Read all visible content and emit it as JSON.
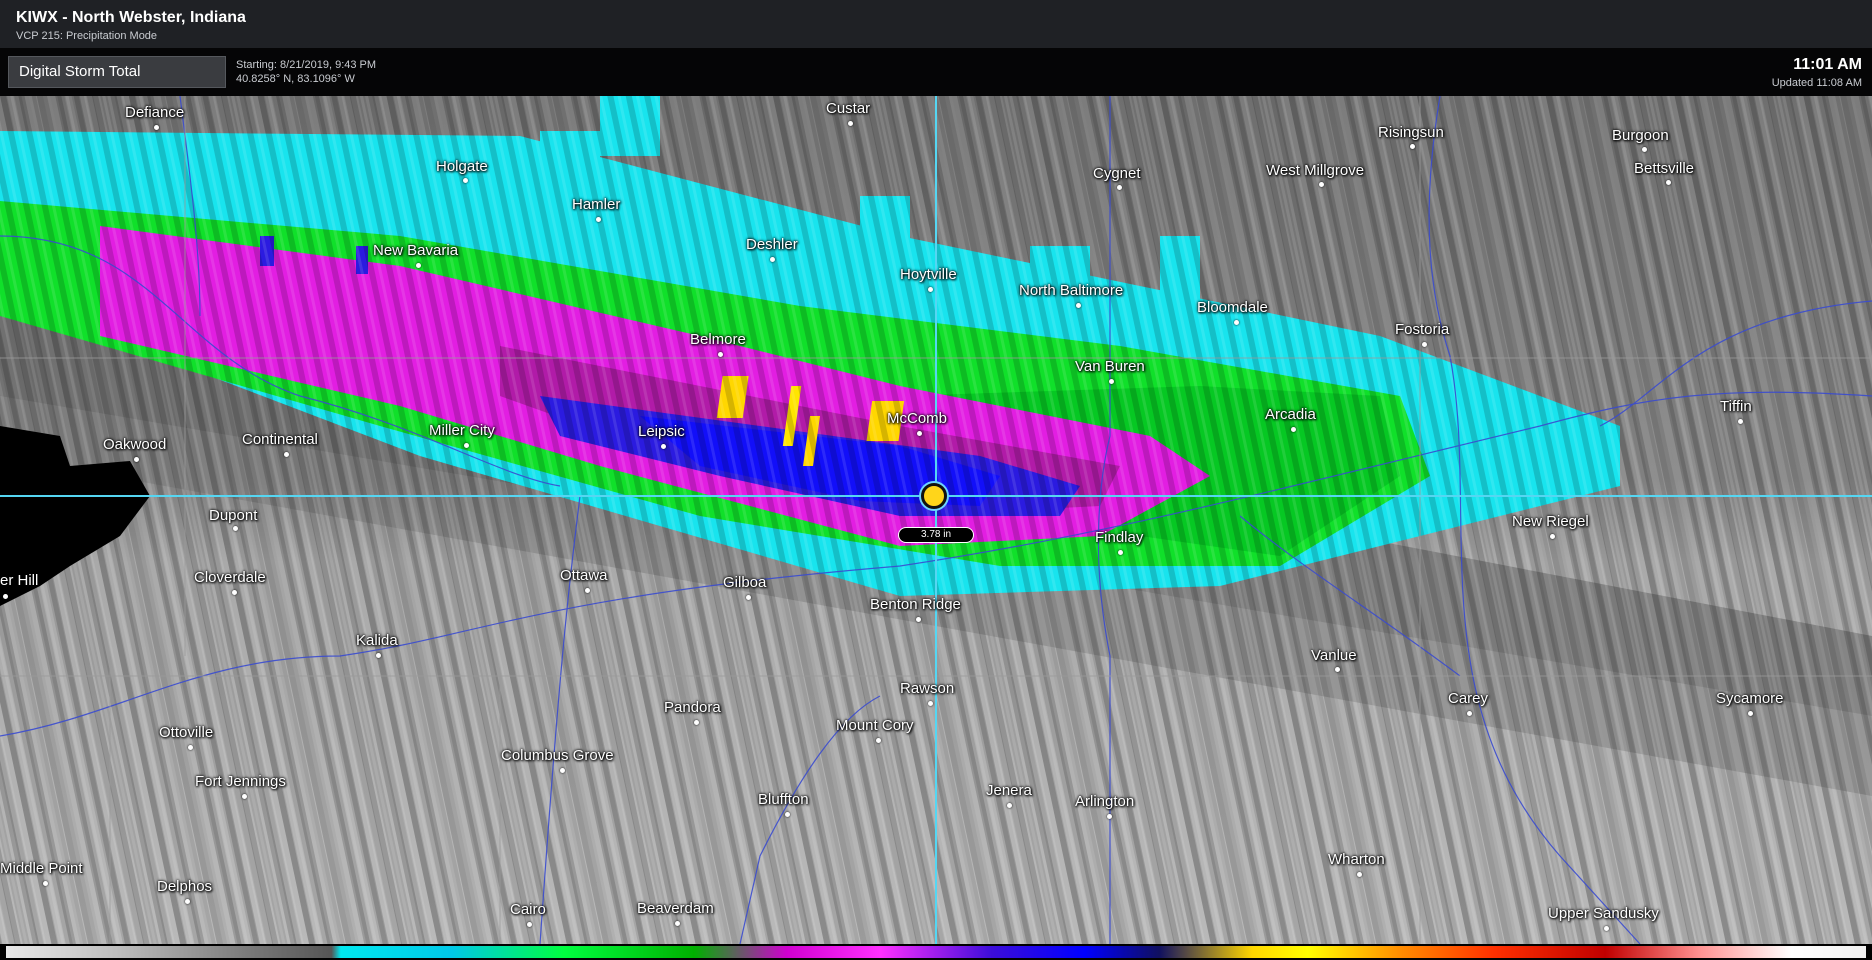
{
  "window": {
    "title": "KIWX - North Webster, Indiana",
    "subtitle": "VCP 215: Precipitation Mode"
  },
  "toolbar": {
    "product": "Digital Storm Total",
    "starting": "Starting: 8/21/2019, 9:43 PM",
    "coords": "40.8258° N, 83.1096° W",
    "time": "11:01 AM",
    "updated": "Updated 11:08 AM"
  },
  "probe": {
    "value": "3.78 in"
  },
  "cities": [
    {
      "name": "Defiance"
    },
    {
      "name": "Custar"
    },
    {
      "name": "Risingsun"
    },
    {
      "name": "Burgoon"
    },
    {
      "name": "Holgate"
    },
    {
      "name": "Cygnet"
    },
    {
      "name": "West Millgrove"
    },
    {
      "name": "Bettsville"
    },
    {
      "name": "Hamler"
    },
    {
      "name": "Deshler"
    },
    {
      "name": "New Bavaria"
    },
    {
      "name": "Hoytville"
    },
    {
      "name": "North Baltimore"
    },
    {
      "name": "Bloomdale"
    },
    {
      "name": "Fostoria"
    },
    {
      "name": "Belmore"
    },
    {
      "name": "Van Buren"
    },
    {
      "name": "Arcadia"
    },
    {
      "name": "Tiffin"
    },
    {
      "name": "Oakwood"
    },
    {
      "name": "Continental"
    },
    {
      "name": "Miller City"
    },
    {
      "name": "Leipsic"
    },
    {
      "name": "McComb"
    },
    {
      "name": "Dupont"
    },
    {
      "name": "Findlay"
    },
    {
      "name": "New Riegel"
    },
    {
      "name": "Cloverdale"
    },
    {
      "name": "Ottawa"
    },
    {
      "name": "Gilboa"
    },
    {
      "name": "Benton Ridge"
    },
    {
      "name": "Kalida"
    },
    {
      "name": "Vanlue"
    },
    {
      "name": "Rawson"
    },
    {
      "name": "Carey"
    },
    {
      "name": "Sycamore"
    },
    {
      "name": "Pandora"
    },
    {
      "name": "Ottoville"
    },
    {
      "name": "Mount Cory"
    },
    {
      "name": "Columbus Grove"
    },
    {
      "name": "Fort Jennings"
    },
    {
      "name": "Bluffton"
    },
    {
      "name": "Jenera"
    },
    {
      "name": "Arlington"
    },
    {
      "name": "Wharton"
    },
    {
      "name": "Middle Point"
    },
    {
      "name": "Delphos"
    },
    {
      "name": "Cairo"
    },
    {
      "name": "Beaverdam"
    },
    {
      "name": "Upper Sandusky"
    },
    {
      "name": "er Hill"
    }
  ]
}
